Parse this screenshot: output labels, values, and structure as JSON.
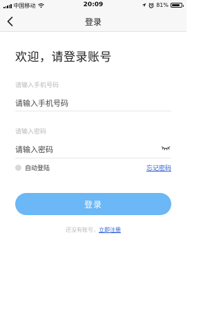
{
  "status_bar": {
    "carrier": "中国移动",
    "time": "20:09",
    "battery": "81%",
    "battery_level": 0.81,
    "icons": [
      "signal-icon",
      "wifi-icon",
      "location-icon",
      "alarm-icon",
      "battery-icon"
    ]
  },
  "nav": {
    "title": "登录",
    "back_icon": "chevron-left-icon"
  },
  "welcome": "欢迎，请登录账号",
  "phone": {
    "label": "请输入手机号码",
    "placeholder": "请输入手机号码",
    "value": ""
  },
  "password": {
    "label": "请输入密码",
    "placeholder": "请输入密码",
    "value": "",
    "toggle_icon": "eye-closed-icon"
  },
  "auto_login": {
    "label": "自动登陆",
    "checked": false
  },
  "forgot_password": "忘记密码",
  "login_button": "登录",
  "register": {
    "hint": "还没有账号，",
    "link": "立即注册"
  },
  "colors": {
    "accent": "#6cb7f5",
    "link": "#2d5fd4",
    "muted": "#b8b8b8",
    "nav_bg": "#f7f7f7"
  }
}
